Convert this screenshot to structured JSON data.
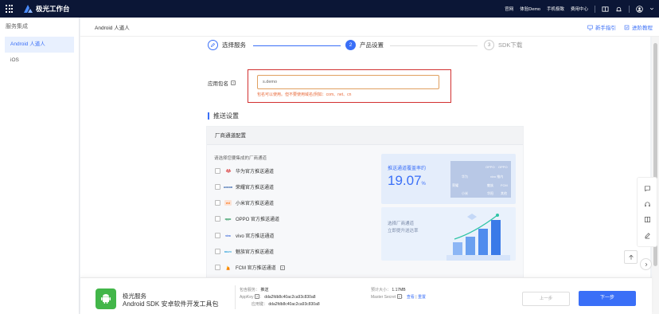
{
  "topbar": {
    "logo_text": "极光工作台",
    "links": [
      "官网",
      "体验Demo",
      "手机极致",
      "费用中心"
    ]
  },
  "sidebar": {
    "title": "服务集成",
    "items": [
      {
        "label": "Android 人道人",
        "active": true
      },
      {
        "label": "iOS",
        "active": false
      }
    ]
  },
  "breadcrumb": {
    "title": "Android 人道人",
    "guide_label": "新手指引",
    "advanced_label": "进阶教程"
  },
  "steps": [
    {
      "num": "1",
      "label": "选择服务",
      "state": "done"
    },
    {
      "num": "2",
      "label": "产品设置",
      "state": "active"
    },
    {
      "num": "3",
      "label": "SDK下载",
      "state": "todo"
    }
  ],
  "form": {
    "app_name_label": "应用包名",
    "app_name_value": "s.demo",
    "hint": "包名可以使用。但不要使用域名(例如：com、net、cn"
  },
  "push": {
    "section_title": "推送设置",
    "panel_title": "厂商通道配置",
    "choose_label": "请选择您要集成的厂商通道",
    "vendors": [
      {
        "label": "华为官方推送通道",
        "icon": "huawei-icon"
      },
      {
        "label": "荣耀官方推送通道",
        "icon": "honor-icon"
      },
      {
        "label": "小米官方推送通道",
        "icon": "xiaomi-icon"
      },
      {
        "label": "OPPO 官方推送通道",
        "icon": "oppo-icon"
      },
      {
        "label": "vivo 官方推送通道",
        "icon": "vivo-icon"
      },
      {
        "label": "魅族官方推送通道",
        "icon": "meizu-icon"
      },
      {
        "label": "FCM 官方推送通道",
        "icon": "fcm-icon"
      }
    ],
    "stat_title": "推送通道覆盖率约",
    "stat_value": "19.07",
    "stat_unit": "%",
    "table_cells": [
      "OPPO",
      "OPPO",
      "华为",
      "vivo 推内",
      "荣耀",
      "魅族",
      "FCM",
      "小米",
      "华阳",
      "其他"
    ],
    "promo_line1": "选择厂商通道",
    "promo_line2": "立即提升送达率"
  },
  "bottom": {
    "app_title": "极光服务",
    "app_sub": "Android SDK 安卓软件开发工具包",
    "included_label": "包含服务：",
    "included_value": "推送",
    "appkey_label": "AppKey",
    "appkey_value": "dda2fdb8c40ac2ca93c830a8",
    "app_id_label": "应用键：",
    "app_id_value": "dda2fdb8c40ac2ca93c830a8",
    "size_label": "预计大小：",
    "size_value": "1.17MB",
    "secret_label": "Master Secret",
    "secret_view": "查看",
    "secret_reset": "重置",
    "prev_label": "上一步",
    "next_label": "下一步"
  },
  "colors": {
    "accent": "#3a6ff7",
    "topbar": "#0b1636",
    "warn": "#e86a3a",
    "highlight": "#d23030"
  }
}
